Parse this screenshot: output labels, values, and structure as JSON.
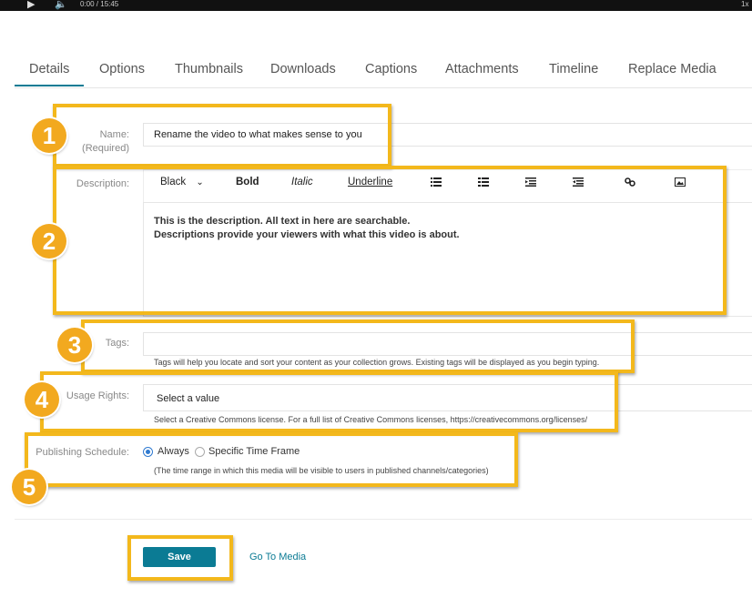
{
  "player": {
    "time": "0:00 / 15:45",
    "speed": "1x"
  },
  "tabs": [
    {
      "label": "Details"
    },
    {
      "label": "Options"
    },
    {
      "label": "Thumbnails"
    },
    {
      "label": "Downloads"
    },
    {
      "label": "Captions"
    },
    {
      "label": "Attachments"
    },
    {
      "label": "Timeline"
    },
    {
      "label": "Replace Media"
    }
  ],
  "name": {
    "label": "Name:",
    "sublabel": "(Required)",
    "value": "Rename the video to what makes sense to you"
  },
  "description": {
    "label": "Description:",
    "toolbar": {
      "color": "Black",
      "bold": "Bold",
      "italic": "Italic",
      "underline": "Underline"
    },
    "line1": "This is the description. All text in here are searchable.",
    "line2": "Descriptions provide your viewers with what this video is about."
  },
  "tags": {
    "label": "Tags:",
    "value": "",
    "help": "Tags will help you locate and sort your content as your collection grows. Existing tags will be displayed as you begin typing."
  },
  "usage": {
    "label": "Usage Rights:",
    "value": "Select a value",
    "help": "Select a Creative Commons license. For a full list of Creative Commons licenses, https://creativecommons.org/licenses/"
  },
  "schedule": {
    "label": "Publishing Schedule:",
    "opt_always": "Always",
    "opt_specific": "Specific Time Frame",
    "selected": "Always",
    "help": "(The time range in which this media will be visible to users in published channels/categories)"
  },
  "actions": {
    "save": "Save",
    "goto": "Go To Media"
  },
  "badges": [
    "1",
    "2",
    "3",
    "4",
    "5"
  ],
  "colors": {
    "accent": "#0b7b94",
    "highlight": "#f3b81c",
    "badge": "#f2a91f"
  }
}
